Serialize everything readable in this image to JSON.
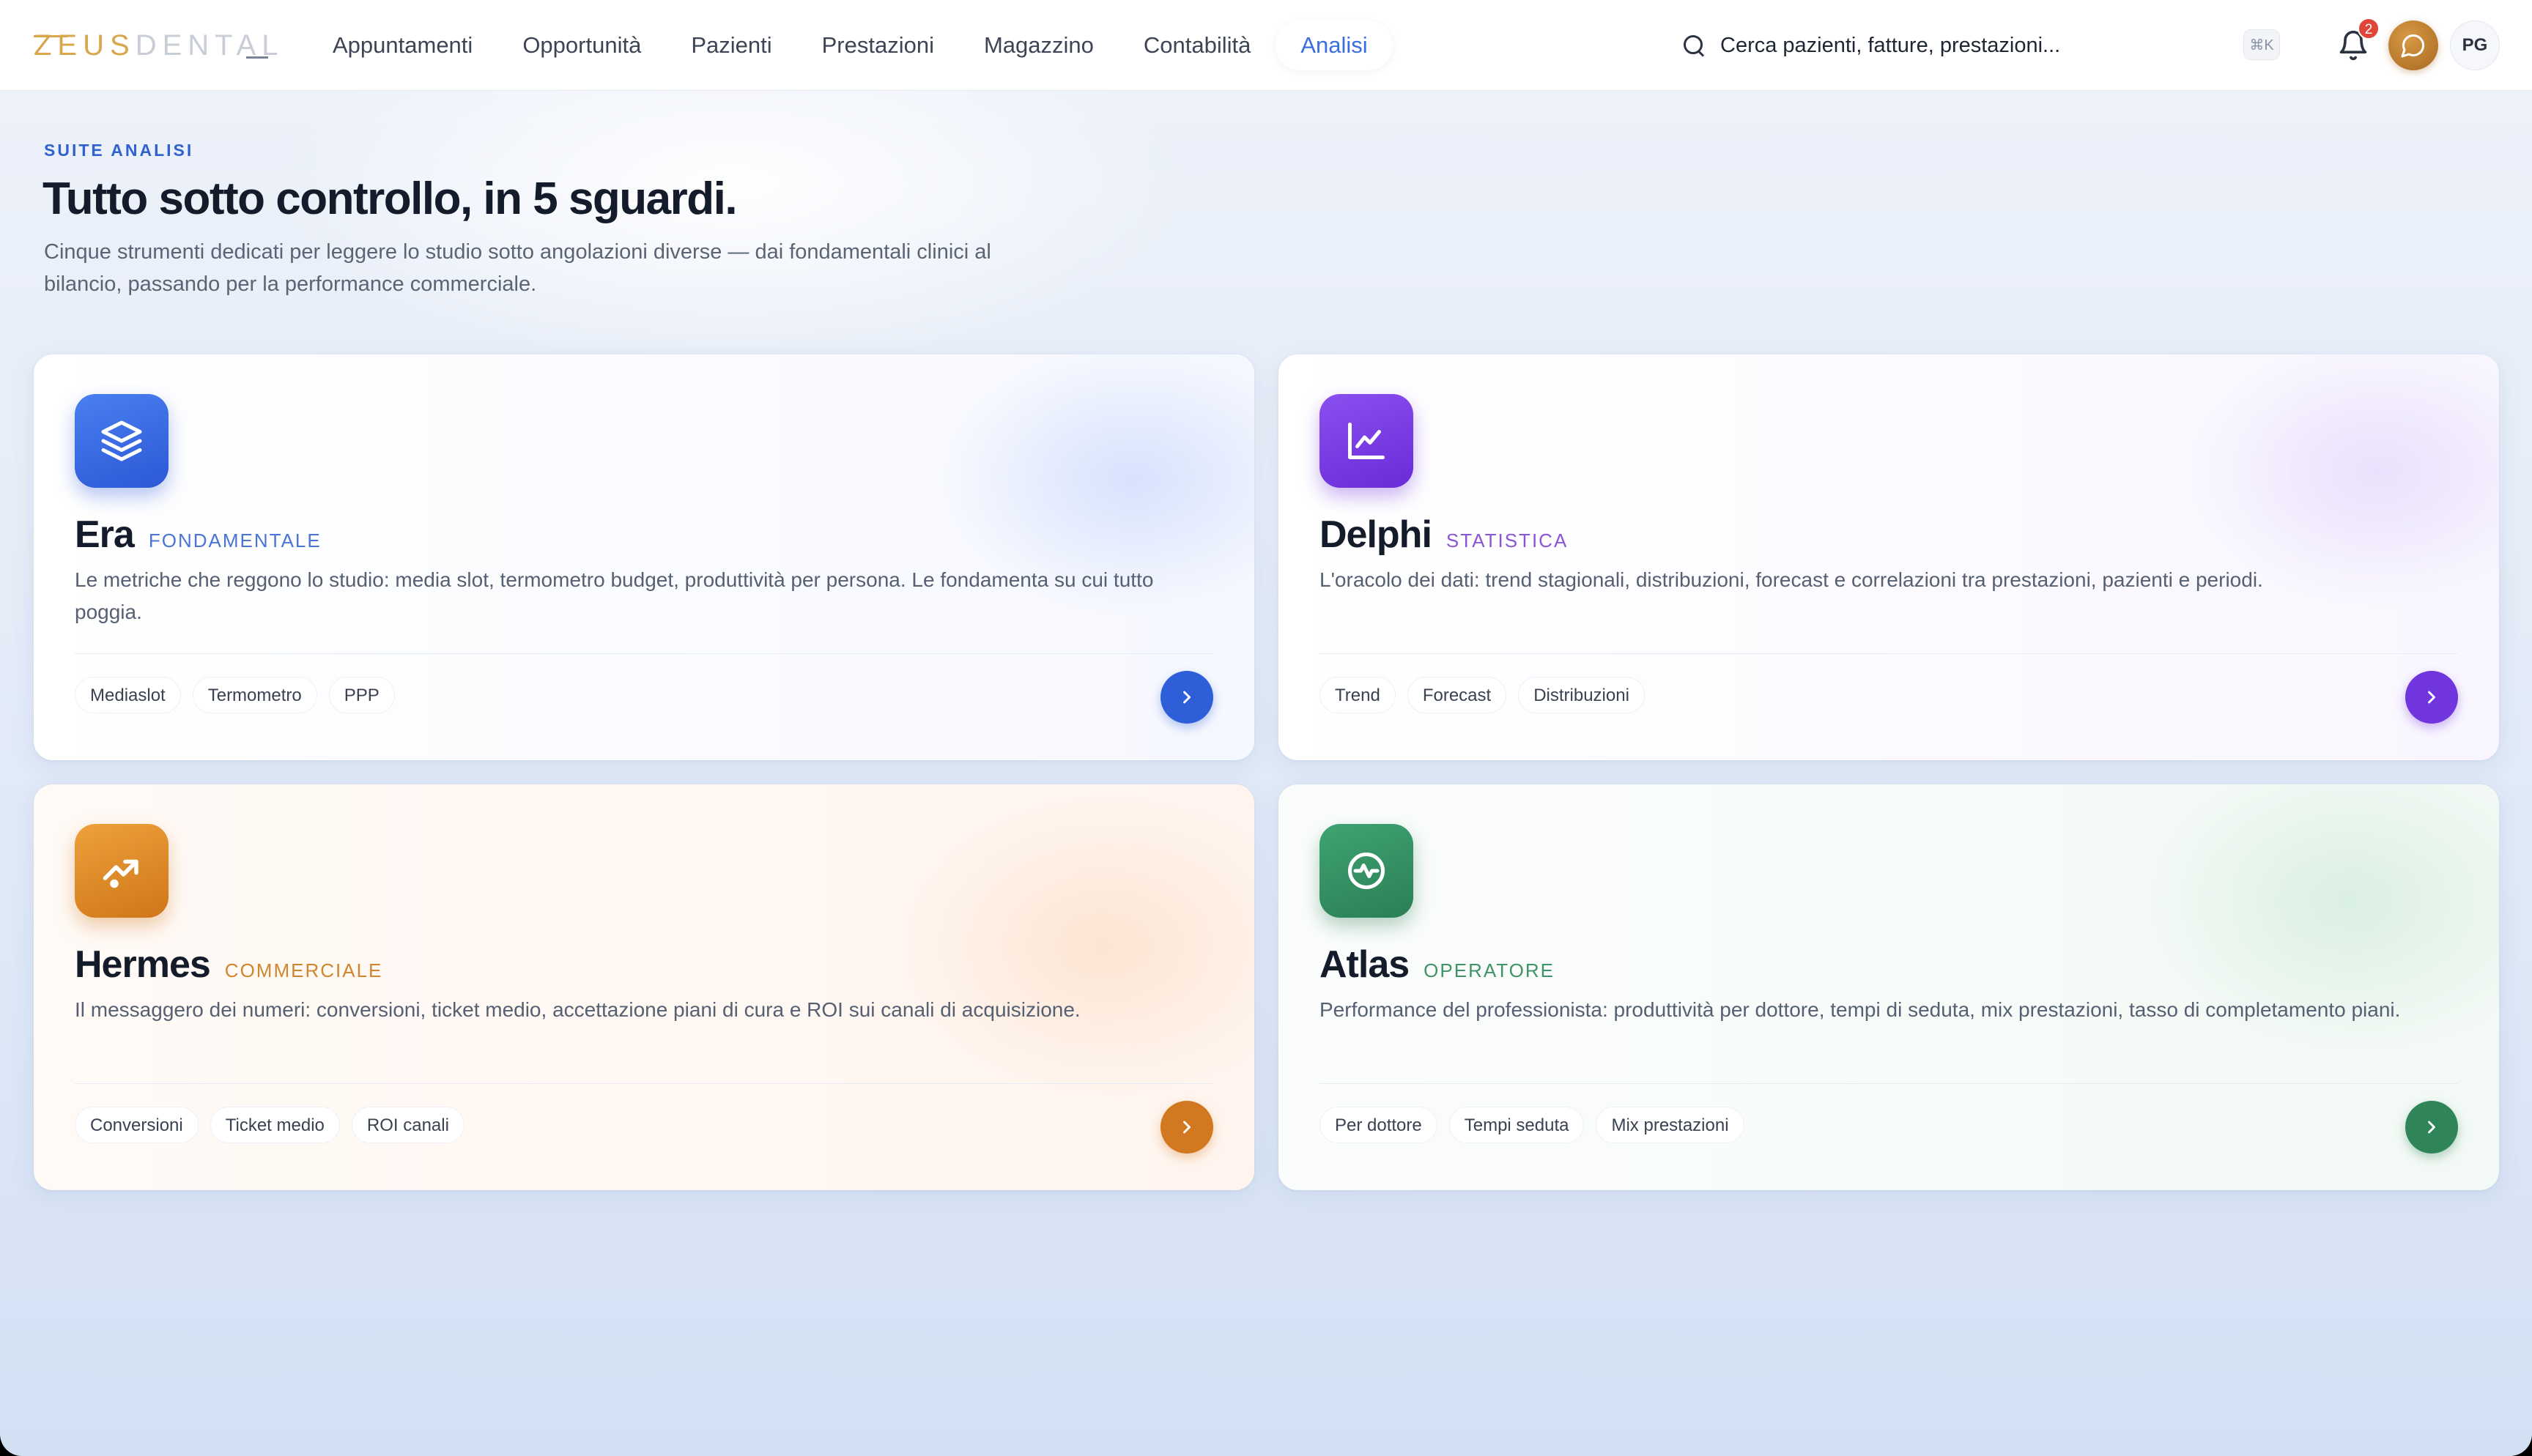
{
  "brand": {
    "logo_text": "ZEUSDENTAL"
  },
  "nav": {
    "items": [
      {
        "label": "Appuntamenti"
      },
      {
        "label": "Opportunità"
      },
      {
        "label": "Pazienti"
      },
      {
        "label": "Prestazioni"
      },
      {
        "label": "Magazzino"
      },
      {
        "label": "Contabilità"
      },
      {
        "label": "Analisi",
        "active": true
      }
    ]
  },
  "search": {
    "placeholder": "Cerca pazienti, fatture, prestazioni...",
    "shortcut": "⌘K",
    "icon": "search-icon"
  },
  "notifications": {
    "count": "2",
    "icon": "bell-icon"
  },
  "user": {
    "initials": "PG"
  },
  "hero": {
    "eyebrow": "SUITE ANALISI",
    "title": "Tutto sotto controllo, in 5 sguardi.",
    "subtitle": "Cinque strumenti dedicati per leggere lo studio sotto angolazioni diverse — dai fondamentali clinici al bilancio, passando per la performance commerciale."
  },
  "cards": [
    {
      "title": "Era",
      "tag": "FONDAMENTALE",
      "icon": "layers-icon",
      "description": "Le metriche che reggono lo studio: media slot, termometro budget, produttività per persona. Le fondamenta su cui tutto poggia.",
      "chips": [
        "Mediaslot",
        "Termometro",
        "PPP"
      ],
      "accent": "#2f5fd8"
    },
    {
      "title": "Delphi",
      "tag": "STATISTICA",
      "icon": "line-chart-icon",
      "description": "L'oracolo dei dati: trend stagionali, distribuzioni, forecast e correlazioni tra prestazioni, pazienti e periodi.",
      "chips": [
        "Trend",
        "Forecast",
        "Distribuzioni"
      ],
      "accent": "#7035dd"
    },
    {
      "title": "Hermes",
      "tag": "COMMERCIALE",
      "icon": "trending-up-icon",
      "description": "Il messaggero dei numeri: conversioni, ticket medio, accettazione piani di cura e ROI sui canali di acquisizione.",
      "chips": [
        "Conversioni",
        "Ticket medio",
        "ROI canali"
      ],
      "accent": "#d27820"
    },
    {
      "title": "Atlas",
      "tag": "OPERATORE",
      "icon": "activity-icon",
      "description": "Performance del professionista: produttività per dottore, tempi di seduta, mix prestazioni, tasso di completamento piani.",
      "chips": [
        "Per dottore",
        "Tempi seduta",
        "Mix prestazioni"
      ],
      "accent": "#2f8458"
    }
  ]
}
